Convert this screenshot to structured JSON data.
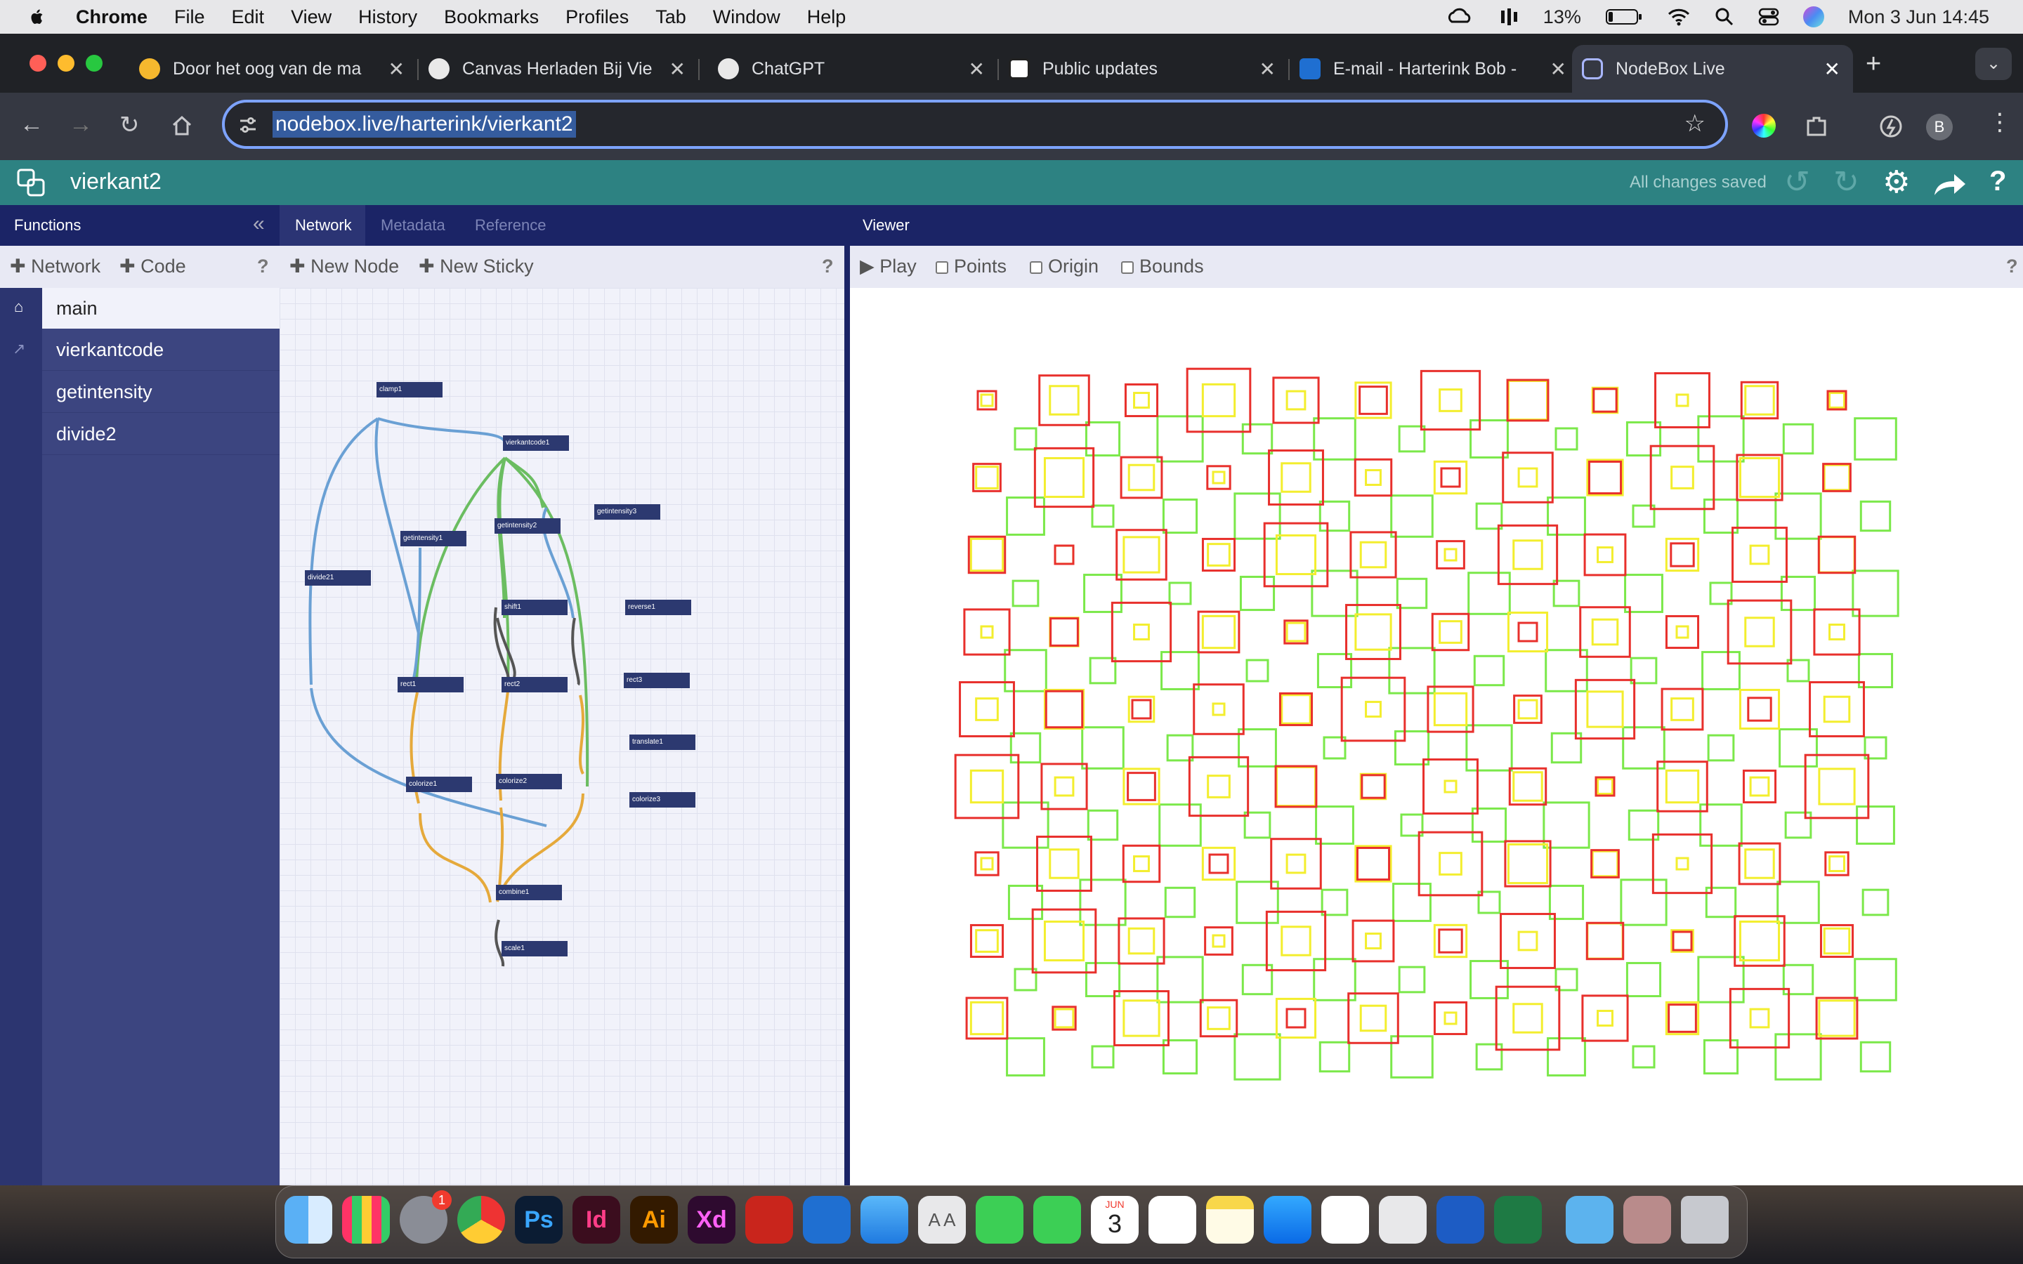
{
  "menubar": {
    "app": "Chrome",
    "items": [
      "File",
      "Edit",
      "View",
      "History",
      "Bookmarks",
      "Profiles",
      "Tab",
      "Window",
      "Help"
    ],
    "battery": "13%",
    "datetime": "Mon 3 Jun  14:45"
  },
  "tabs": [
    {
      "title": "Door het oog van de ma",
      "color": "#f5b82e"
    },
    {
      "title": "Canvas Herladen Bij Vie",
      "color": "#e9e9e9"
    },
    {
      "title": "ChatGPT",
      "color": "#e9e9e9"
    },
    {
      "title": "Public updates",
      "color": "#ffffff"
    },
    {
      "title": "E-mail - Harterink Bob -",
      "color": "#1f6fd1"
    },
    {
      "title": "NodeBox Live",
      "color": "#2b5bd7"
    }
  ],
  "toolbar": {
    "url": "nodebox.live/harterink/vierkant2",
    "profile": "B"
  },
  "app": {
    "title": "vierkant2",
    "saved": "All changes saved",
    "help": "?"
  },
  "functions": {
    "header": "Functions",
    "add_network": "Network",
    "add_code": "Code",
    "help": "?",
    "items": [
      "main",
      "vierkantcode",
      "getintensity",
      "divide2"
    ]
  },
  "network": {
    "tabs": [
      "Network",
      "Metadata",
      "Reference"
    ],
    "new_node": "New Node",
    "new_sticky": "New Sticky",
    "help": "?",
    "nodes": [
      "clamp1",
      "vierkantcode1",
      "getintensity1",
      "getintensity2",
      "getintensity3",
      "divide21",
      "shift1",
      "reverse1",
      "rect1",
      "rect2",
      "rect3",
      "translate1",
      "colorize1",
      "colorize2",
      "colorize3",
      "combine1",
      "scale1"
    ]
  },
  "viewer": {
    "header": "Viewer",
    "play": "Play",
    "points": "Points",
    "origin": "Origin",
    "bounds": "Bounds",
    "help": "?",
    "colors": {
      "red": "#e8302c",
      "yellow": "#f3ee2e",
      "green": "#7be84a"
    }
  },
  "dock": {
    "badge": "1",
    "calendar_month": "JUN",
    "calendar_day": "3",
    "apps": [
      "Finder",
      "Launchpad",
      "System Settings",
      "Chrome",
      "Photoshop",
      "InDesign",
      "Illustrator",
      "Adobe XD",
      "Acrobat",
      "VS Code",
      "Mail",
      "Font Book",
      "FaceTime",
      "Messages",
      "Calendar",
      "Reminders",
      "Notes",
      "App Store",
      "Photos",
      "Blender",
      "Word",
      "Excel",
      "Downloads",
      "Preview",
      "Trash"
    ]
  }
}
